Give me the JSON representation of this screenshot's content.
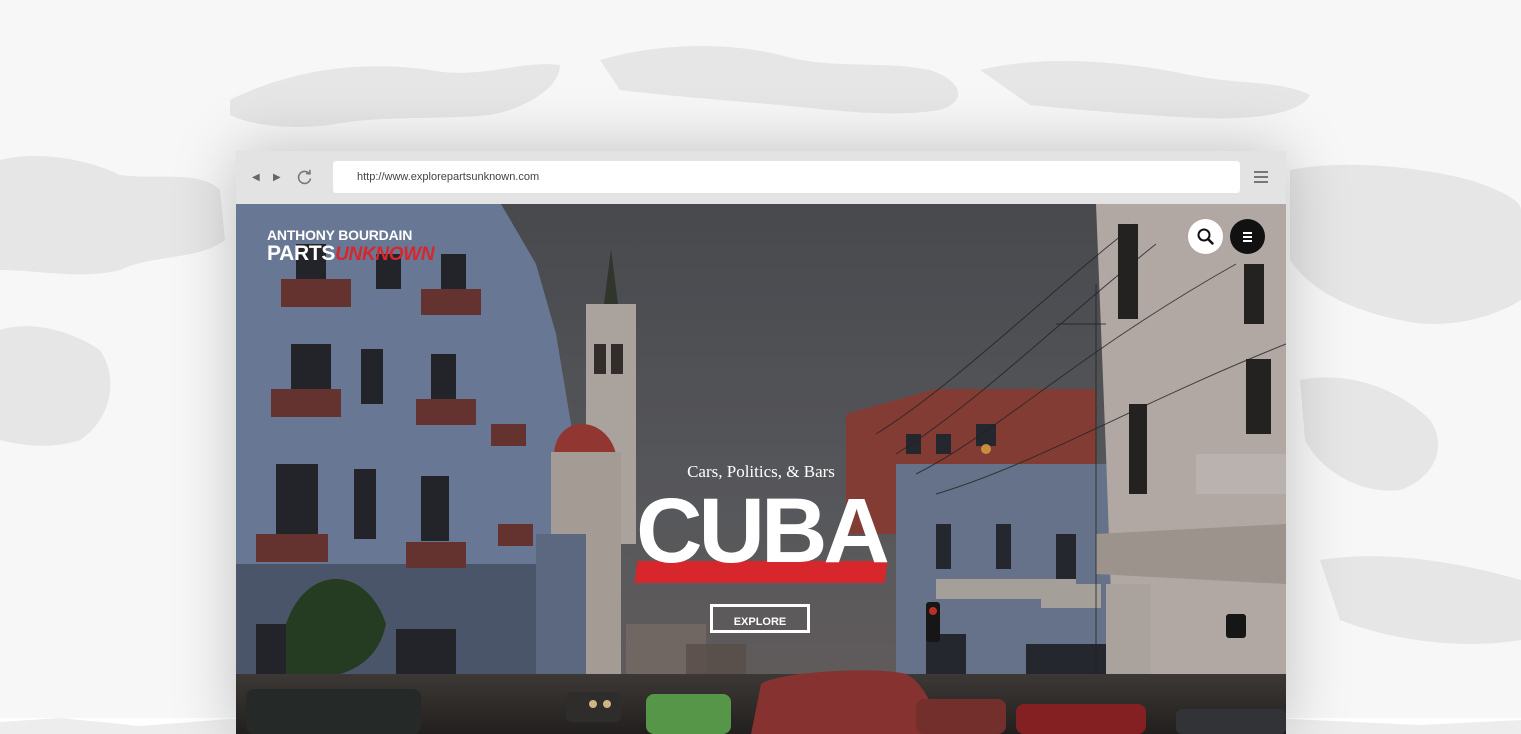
{
  "browser": {
    "back_icon": "back-arrow-icon",
    "forward_icon": "forward-arrow-icon",
    "reload_icon": "reload-icon",
    "url": "http://www.explorepartsunknown.com",
    "menu_icon": "hamburger-menu-icon"
  },
  "site": {
    "logo_top": "ANTHONY BOURDAIN",
    "logo_bottom_main": "PARTS",
    "logo_bottom_accent": "UNKNOWN",
    "search_icon": "search-icon",
    "menu_icon": "menu-icon"
  },
  "hero": {
    "subtitle": "Cars, Politics, & Bars",
    "title": "CUBA",
    "cta_label": "EXPLORE"
  },
  "colors": {
    "accent_red": "#d7262c",
    "chrome_gray": "#e3e3e3",
    "page_bg": "#f7f7f7"
  }
}
